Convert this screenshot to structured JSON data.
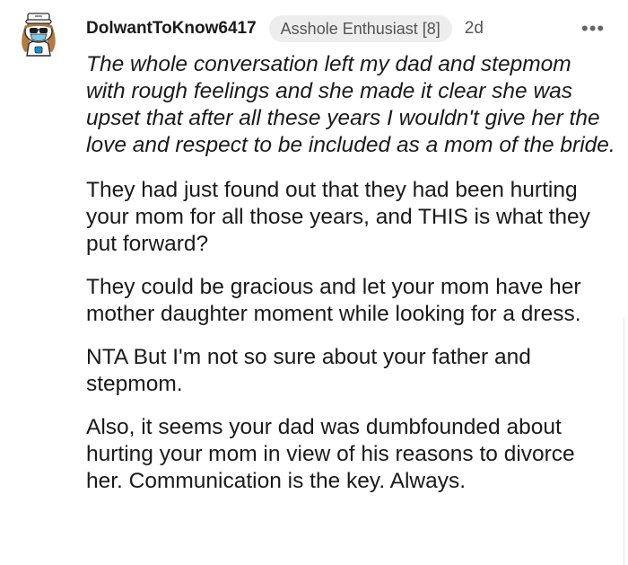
{
  "comment": {
    "username": "DolwantToKnow6417",
    "flair": "Asshole Enthusiast [8]",
    "age": "2d",
    "more_icon": "more-horizontal-icon",
    "avatar_icon": "snoo-avatar-icon",
    "paragraphs": [
      {
        "style": "italic",
        "text": "The whole conversation left my dad and stepmom with rough feelings and she made it clear she was upset that after all these years I wouldn't give her the love and respect to be included as a mom of the bride."
      },
      {
        "style": "normal",
        "text": "They had just found out that they had been hurting your mom for all those years, and THIS is what they put forward?"
      },
      {
        "style": "normal",
        "text": "They could be gracious and let your mom have her mother daughter moment while looking for a dress."
      },
      {
        "style": "normal",
        "text": "NTA But I'm not so sure about your father and stepmom."
      },
      {
        "style": "normal",
        "text": "Also, it seems your dad was dumbfounded about hurting your mom in view of his reasons to divorce her. Communication is the key. Always."
      }
    ]
  }
}
